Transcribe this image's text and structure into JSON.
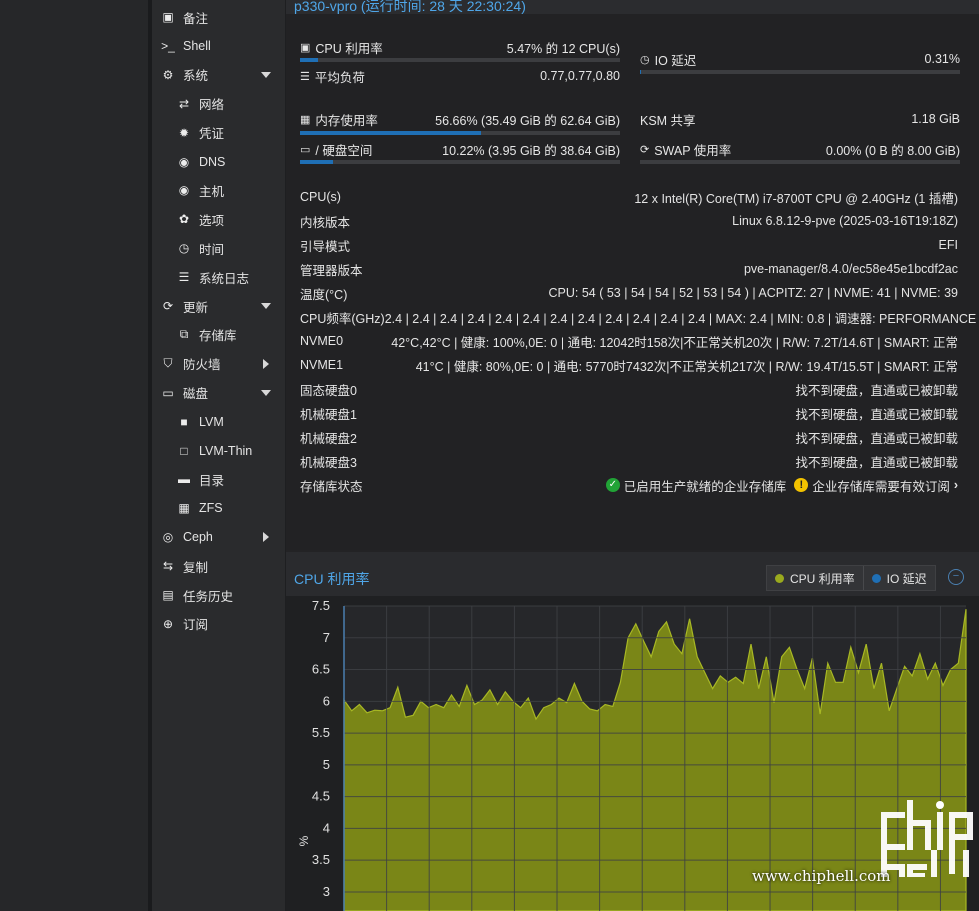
{
  "sidebar": {
    "items": [
      {
        "label": "备注",
        "icon": "notes-icon",
        "level": 0
      },
      {
        "label": "Shell",
        "icon": "terminal-icon",
        "level": 0
      },
      {
        "label": "系统",
        "icon": "cogs-icon",
        "level": 0,
        "caret": "down"
      },
      {
        "label": "网络",
        "icon": "network-icon",
        "level": 1
      },
      {
        "label": "凭证",
        "icon": "certificate-icon",
        "level": 1
      },
      {
        "label": "DNS",
        "icon": "globe-icon",
        "level": 1
      },
      {
        "label": "主机",
        "icon": "globe-icon",
        "level": 1
      },
      {
        "label": "选项",
        "icon": "gear-icon",
        "level": 1
      },
      {
        "label": "时间",
        "icon": "clock-icon",
        "level": 1
      },
      {
        "label": "系统日志",
        "icon": "list-icon",
        "level": 1
      },
      {
        "label": "更新",
        "icon": "refresh-icon",
        "level": 0,
        "caret": "down"
      },
      {
        "label": "存储库",
        "icon": "repository-icon",
        "level": 1
      },
      {
        "label": "防火墙",
        "icon": "shield-icon",
        "level": 0,
        "caret": "right"
      },
      {
        "label": "磁盘",
        "icon": "hdd-icon",
        "level": 0,
        "caret": "down"
      },
      {
        "label": "LVM",
        "icon": "square-icon",
        "level": 1
      },
      {
        "label": "LVM-Thin",
        "icon": "square-outline-icon",
        "level": 1
      },
      {
        "label": "目录",
        "icon": "folder-icon",
        "level": 1
      },
      {
        "label": "ZFS",
        "icon": "grid-icon",
        "level": 1
      },
      {
        "label": "Ceph",
        "icon": "ceph-icon",
        "level": 0,
        "caret": "right"
      },
      {
        "label": "复制",
        "icon": "retweet-icon",
        "level": 0
      },
      {
        "label": "任务历史",
        "icon": "list-alt-icon",
        "level": 0
      },
      {
        "label": "订阅",
        "icon": "support-icon",
        "level": 0
      }
    ]
  },
  "header": {
    "title": "p330-vpro (运行时间: 28 天 22:30:24)"
  },
  "summary": {
    "cpu": {
      "label": "CPU 利用率",
      "value": "5.47% 的 12 CPU(s)",
      "fraction": 0.0547
    },
    "load": {
      "label": "平均负荷",
      "value": "0.77,0.77,0.80"
    },
    "io": {
      "label": "IO 延迟",
      "value": "0.31%",
      "fraction": 0.0031
    },
    "mem": {
      "label": "内存使用率",
      "value": "56.66% (35.49 GiB 的 62.64 GiB)",
      "fraction": 0.5666
    },
    "ksm": {
      "label": "KSM 共享",
      "value": "1.18 GiB"
    },
    "disk": {
      "label": "/ 硬盘空间",
      "value": "10.22% (3.95 GiB 的 38.64 GiB)",
      "fraction": 0.1022
    },
    "swap": {
      "label": "SWAP 使用率",
      "value": "0.00% (0 B 的 8.00 GiB)",
      "fraction": 0.0
    },
    "info": [
      {
        "k": "CPU(s)",
        "v": "12 x Intel(R) Core(TM) i7-8700T CPU @ 2.40GHz (1 插槽)"
      },
      {
        "k": "内核版本",
        "v": "Linux 6.8.12-9-pve (2025-03-16T19:18Z)"
      },
      {
        "k": "引导模式",
        "v": "EFI"
      },
      {
        "k": "管理器版本",
        "v": "pve-manager/8.4.0/ec58e45e1bcdf2ac"
      },
      {
        "k": "温度(°C)",
        "v": "CPU: 54 ( 53 | 54 | 54 | 52 | 53 | 54 ) | ACPITZ: 27 | NVME: 41 | NVME: 39"
      },
      {
        "k": "CPU频率(GHz)",
        "v": "2.4 | 2.4 | 2.4 | 2.4 | 2.4 | 2.4 | 2.4 | 2.4 | 2.4 | 2.4 | 2.4 | 2.4 | MAX: 2.4 | MIN: 0.8 | 调速器: PERFORMANCE"
      },
      {
        "k": "NVME0",
        "v": "42°C,42°C | 健康: 100%,0E: 0 | 通电: 12042时158次|不正常关机20次 | R/W: 7.2T/14.6T | SMART: 正常"
      },
      {
        "k": "NVME1",
        "v": "41°C | 健康: 80%,0E: 0 | 通电: 5770时7432次|不正常关机217次 | R/W: 19.4T/15.5T | SMART: 正常"
      },
      {
        "k": "固态硬盘0",
        "v": "找不到硬盘，直通或已被卸载"
      },
      {
        "k": "机械硬盘1",
        "v": "找不到硬盘，直通或已被卸载"
      },
      {
        "k": "机械硬盘2",
        "v": "找不到硬盘，直通或已被卸载"
      },
      {
        "k": "机械硬盘3",
        "v": "找不到硬盘，直通或已被卸载"
      }
    ],
    "repo": {
      "k": "存储库状态",
      "ok": "已启用生产就绪的企业存储库",
      "warn": "企业存储库需要有效订阅"
    }
  },
  "chart_data": {
    "type": "area",
    "title": "CPU 利用率",
    "ylabel": "%",
    "ylim": [
      2.7,
      7.5
    ],
    "yticks": [
      3,
      3.5,
      4,
      4.5,
      5,
      5.5,
      6,
      6.5,
      7,
      7.5
    ],
    "series": [
      {
        "name": "CPU 利用率",
        "color": "#9aaa1e",
        "values": [
          6.02,
          5.85,
          5.95,
          5.82,
          5.86,
          5.85,
          5.9,
          6.22,
          5.75,
          5.78,
          6.0,
          5.9,
          5.95,
          5.9,
          6.1,
          5.92,
          6.25,
          5.95,
          6.02,
          6.18,
          5.95,
          6.15,
          6.0,
          5.9,
          6.05,
          5.72,
          5.9,
          5.95,
          6.05,
          5.98,
          6.28,
          6.0,
          5.88,
          5.85,
          5.95,
          5.92,
          6.3,
          7.0,
          7.22,
          6.95,
          6.7,
          7.1,
          7.25,
          6.9,
          6.75,
          7.3,
          6.7,
          6.45,
          6.2,
          6.4,
          6.3,
          6.38,
          6.28,
          6.9,
          6.2,
          6.7,
          5.98,
          6.7,
          6.85,
          6.5,
          6.2,
          6.68,
          5.8,
          6.6,
          6.3,
          6.3,
          6.85,
          6.45,
          6.9,
          6.2,
          6.6,
          5.85,
          6.2,
          6.55,
          6.4,
          6.75,
          6.35,
          6.6,
          6.25,
          6.5,
          6.6,
          7.45
        ]
      },
      {
        "name": "IO 延迟",
        "color": "#1f6fb5",
        "values": []
      }
    ]
  },
  "watermark": {
    "url": "www.chiphell.com"
  },
  "colors": {
    "accent": "#4fa6e8",
    "progress": "#1f6fb5",
    "cpu_series": "#9aaa1e",
    "ok": "#21a336",
    "warn": "#f2c200"
  }
}
